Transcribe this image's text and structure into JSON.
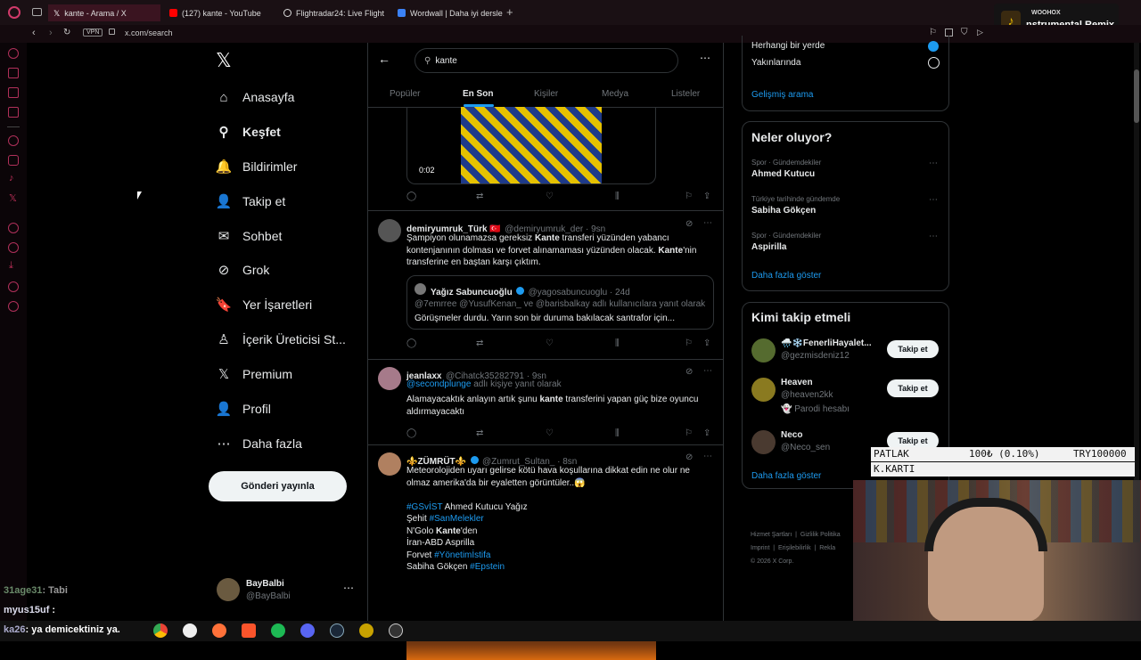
{
  "browser": {
    "tabs": [
      {
        "label": "kante - Arama / X",
        "color": "#ffffff"
      },
      {
        "label": "(127) kante - YouTube",
        "color": "#ff0000"
      },
      {
        "label": "Flightradar24: Live Flight",
        "color": "#dddddd"
      },
      {
        "label": "Wordwall | Daha iyi dersle",
        "color": "#3b82f6"
      }
    ],
    "url": "x.com/search",
    "vpn": "VPN"
  },
  "overlay_top": {
    "brand": "WOOHOX",
    "song": "nstrumental Remix"
  },
  "sidebar": {
    "items": [
      {
        "label": "Anasayfa",
        "icon": "home-icon",
        "glyph": "⌂"
      },
      {
        "label": "Keşfet",
        "icon": "search-icon",
        "glyph": "⚲"
      },
      {
        "label": "Bildirimler",
        "icon": "bell-icon",
        "glyph": "🔔"
      },
      {
        "label": "Takip et",
        "icon": "follow-icon",
        "glyph": "👤"
      },
      {
        "label": "Sohbet",
        "icon": "chat-icon",
        "glyph": "✉"
      },
      {
        "label": "Grok",
        "icon": "grok-icon",
        "glyph": "⊘"
      },
      {
        "label": "Yer İşaretleri",
        "icon": "bookmark-icon",
        "glyph": "🔖"
      },
      {
        "label": "İçerik Üreticisi St...",
        "icon": "creator-icon",
        "glyph": "♙"
      },
      {
        "label": "Premium",
        "icon": "x-icon",
        "glyph": "𝕏"
      },
      {
        "label": "Profil",
        "icon": "profile-icon",
        "glyph": "👤"
      },
      {
        "label": "Daha fazla",
        "icon": "more-icon",
        "glyph": "⋯"
      }
    ],
    "post_button": "Gönderi yayınla",
    "account": {
      "name": "BayBalbi",
      "handle": "@BayBalbi"
    }
  },
  "search": {
    "query": "kante",
    "tabs": [
      "Popüler",
      "En Son",
      "Kişiler",
      "Medya",
      "Listeler"
    ],
    "active_tab": "En Son"
  },
  "top_video": {
    "duration": "0:02"
  },
  "tweets": [
    {
      "name": "demiryumruk_Türk 🇹🇷",
      "handle": "@demiryumruk_der · 9sn",
      "text_html": "Şampiyon olunamazsa gereksiz <b>Kante</b> transferi yüzünden yabancı kontenjanının dolması ve forvet alınamaması yüzünden olacak. <b>Kante</b>'nin transferine en baştan karşı çıktım.",
      "quote": {
        "name": "Yağız Sabuncuoğlu",
        "handle": "@yagosabuncuoglu · 24d",
        "reply_to": "@7emrree @YusufKenan_ ve @barisbalkay adlı kullanıcılara yanıt olarak",
        "text": "Görüşmeler durdu. Yarın son bir duruma bakılacak santrafor için..."
      }
    },
    {
      "name": "jeanlaxx",
      "handle": "@Cihatck35282791 · 9sn",
      "reply_link": "@secondplunge",
      "reply_rest": " adlı kişiye yanıt olarak",
      "text_html": "Alamayacaktık anlayın artık şunu <b>kante</b> transferini yapan güç  bize oyuncu aldırmayacaktı"
    },
    {
      "name": "⚜️ZÜMRÜT⚜️",
      "handle": "@Zumrut_Sultan_ · 8sn",
      "text_html": "Meteorolojiden uyarı gelirse kötü hava koşullarına dikkat edin ne olur ne olmaz amerika'da bir eyaletten görüntüler..😱<br><br><span class='link'>#GSvİST</span> Ahmed Kutucu Yağız<br>Şehit <span class='link'>#SanMelekler</span><br>N'Golo <b>Kante</b>'den<br>İran-ABD Asprilla<br>Forvet <span class='link'>#Yönetimİstifa</span><br>Sabiha Gökçen <span class='link'>#Epstein</span>"
    }
  ],
  "right": {
    "location_options": [
      "Herhangi bir yerde",
      "Yakınlarında"
    ],
    "advanced_search": "Gelişmiş arama",
    "whats_happening": {
      "title": "Neler oluyor?",
      "trends": [
        {
          "context": "Spor · Gündemdekiler",
          "name": "Ahmed Kutucu"
        },
        {
          "context": "Türkiye tarihinde gündemde",
          "name": "Sabiha Gökçen"
        },
        {
          "context": "Spor · Gündemdekiler",
          "name": "Aspirilla"
        }
      ],
      "show_more": "Daha fazla göster"
    },
    "who_to_follow": {
      "title": "Kimi takip etmeli",
      "users": [
        {
          "name": "🌧️❄️FenerliHayalet...",
          "handle": "@gezmisdeniz12",
          "extra": ""
        },
        {
          "name": "Heaven",
          "handle": "@heaven2kk",
          "extra": "👻 Parodi hesabı"
        },
        {
          "name": "Neco",
          "handle": "@Neco_sen",
          "extra": ""
        }
      ],
      "follow_label": "Takip et",
      "show_more": "Daha fazla göster"
    },
    "footer": [
      "Hizmet Şartları",
      "Gizlilik Politika",
      "Imprint",
      "Erişilebilirlik",
      "Rekla",
      "© 2026 X Corp."
    ]
  },
  "stream_overlay": {
    "row1": {
      "left": "PATLAK",
      "mid": "100₺ (0.10%)",
      "right": "TRY100000"
    },
    "row2": "K.KARTI"
  },
  "chat": [
    {
      "user": "31age31",
      "msg": ": Tabi"
    },
    {
      "user": "myus15uf",
      "msg": " :"
    },
    {
      "user": "ka26",
      "msg": ": ya demicektiniz ya."
    }
  ]
}
